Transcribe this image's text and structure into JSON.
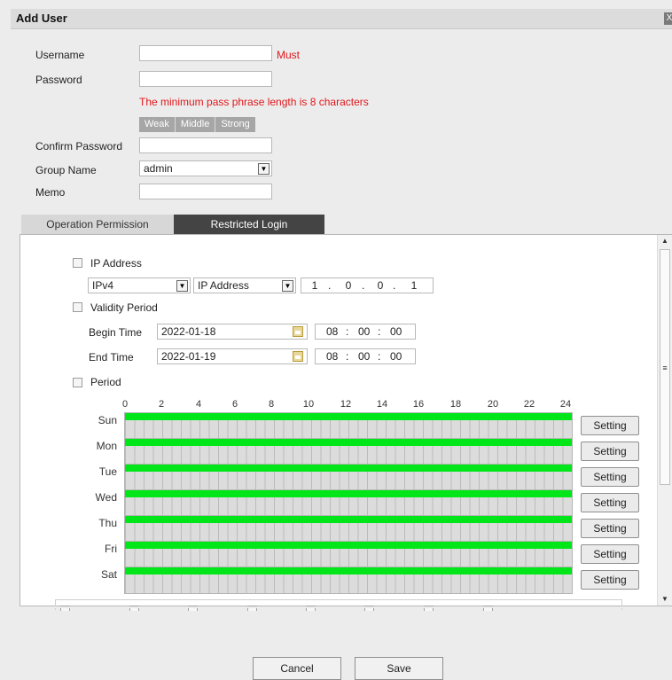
{
  "dialog": {
    "title": "Add User",
    "close_label": "X"
  },
  "form": {
    "username_label": "Username",
    "username_value": "",
    "username_must": "Must",
    "password_label": "Password",
    "password_value": "",
    "password_hint": "The minimum pass phrase length is 8 characters",
    "strength": [
      "Weak",
      "Middle",
      "Strong"
    ],
    "confirm_label": "Confirm Password",
    "confirm_value": "",
    "group_label": "Group Name",
    "group_value": "admin",
    "memo_label": "Memo",
    "memo_value": ""
  },
  "tabs": {
    "operation": "Operation Permission",
    "restricted": "Restricted Login",
    "active": "Restricted Login"
  },
  "restricted": {
    "ip_label": "IP Address",
    "ip_checked": false,
    "ip_version": "IPv4",
    "ip_type": "IP Address",
    "ip_octets": [
      "1",
      "0",
      "0",
      "1"
    ],
    "validity_label": "Validity Period",
    "validity_checked": false,
    "begin_label": "Begin Time",
    "begin_date": "2022-01-18",
    "begin_time": [
      "08",
      "00",
      "00"
    ],
    "end_label": "End Time",
    "end_date": "2022-01-19",
    "end_time": [
      "08",
      "00",
      "00"
    ],
    "period_label": "Period",
    "period_checked": false
  },
  "schedule": {
    "hours": [
      "0",
      "2",
      "4",
      "6",
      "8",
      "10",
      "12",
      "14",
      "16",
      "18",
      "20",
      "22",
      "24"
    ],
    "days": [
      "Sun",
      "Mon",
      "Tue",
      "Wed",
      "Thu",
      "Fri",
      "Sat"
    ],
    "setting_label": "Setting",
    "active_color": "#00e619"
  },
  "footer": {
    "cancel": "Cancel",
    "save": "Save"
  }
}
